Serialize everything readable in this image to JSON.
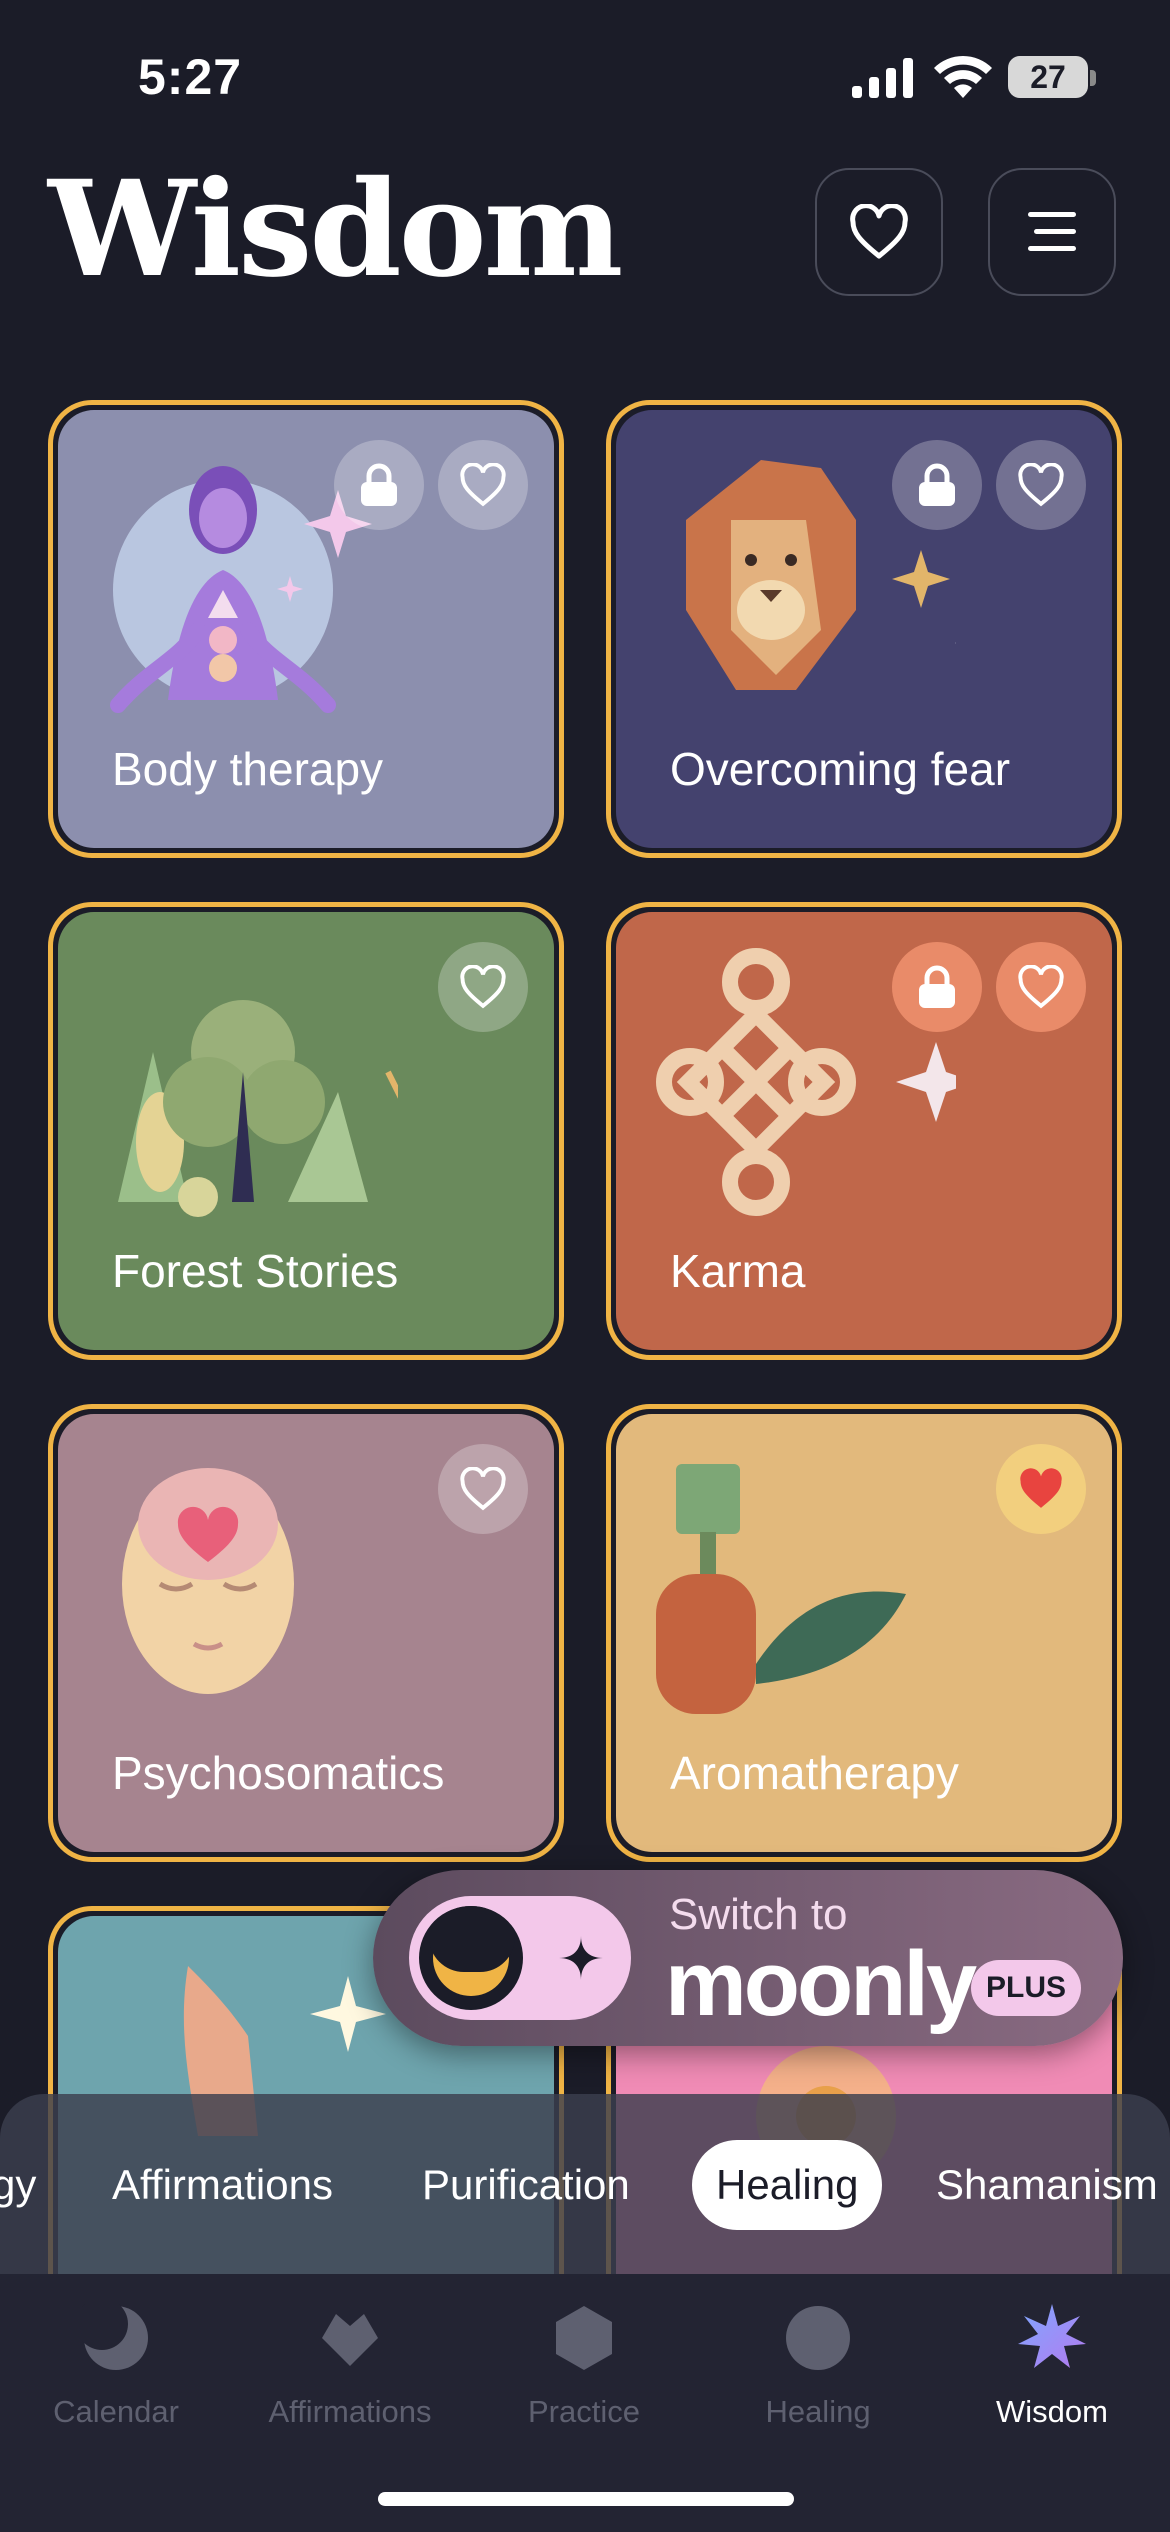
{
  "status_bar": {
    "time": "5:27",
    "battery": "27"
  },
  "header": {
    "title": "Wisdom"
  },
  "cards": [
    {
      "label": "Body therapy",
      "locked": true,
      "favorited": false,
      "bg": "#8c8fae"
    },
    {
      "label": "Overcoming fear",
      "locked": true,
      "favorited": false,
      "bg": "#44426e"
    },
    {
      "label": "Forest Stories",
      "locked": false,
      "favorited": false,
      "bg": "#6a8a5c"
    },
    {
      "label": "Karma",
      "locked": true,
      "favorited": false,
      "bg": "#c0674a"
    },
    {
      "label": "Psychosomatics",
      "locked": false,
      "favorited": false,
      "bg": "#a6848f"
    },
    {
      "label": "Aromatherapy",
      "locked": false,
      "favorited": true,
      "bg": "#e2b97c"
    }
  ],
  "promo": {
    "switch_text": "Switch to",
    "brand": "moonly",
    "badge": "PLUS"
  },
  "categories": {
    "items": [
      "gy",
      "Affirmations",
      "Purification",
      "Healing",
      "Shamanism"
    ],
    "selected": "Healing"
  },
  "tabs": [
    {
      "label": "Calendar",
      "icon": "moon-icon"
    },
    {
      "label": "Affirmations",
      "icon": "heart-icon"
    },
    {
      "label": "Practice",
      "icon": "hexagon-icon"
    },
    {
      "label": "Healing",
      "icon": "circle-icon"
    },
    {
      "label": "Wisdom",
      "icon": "star-burst-icon",
      "active": true
    }
  ],
  "colors": {
    "accent": "#f0b445",
    "background": "#1b1c28",
    "favorite": "#e8443f"
  }
}
